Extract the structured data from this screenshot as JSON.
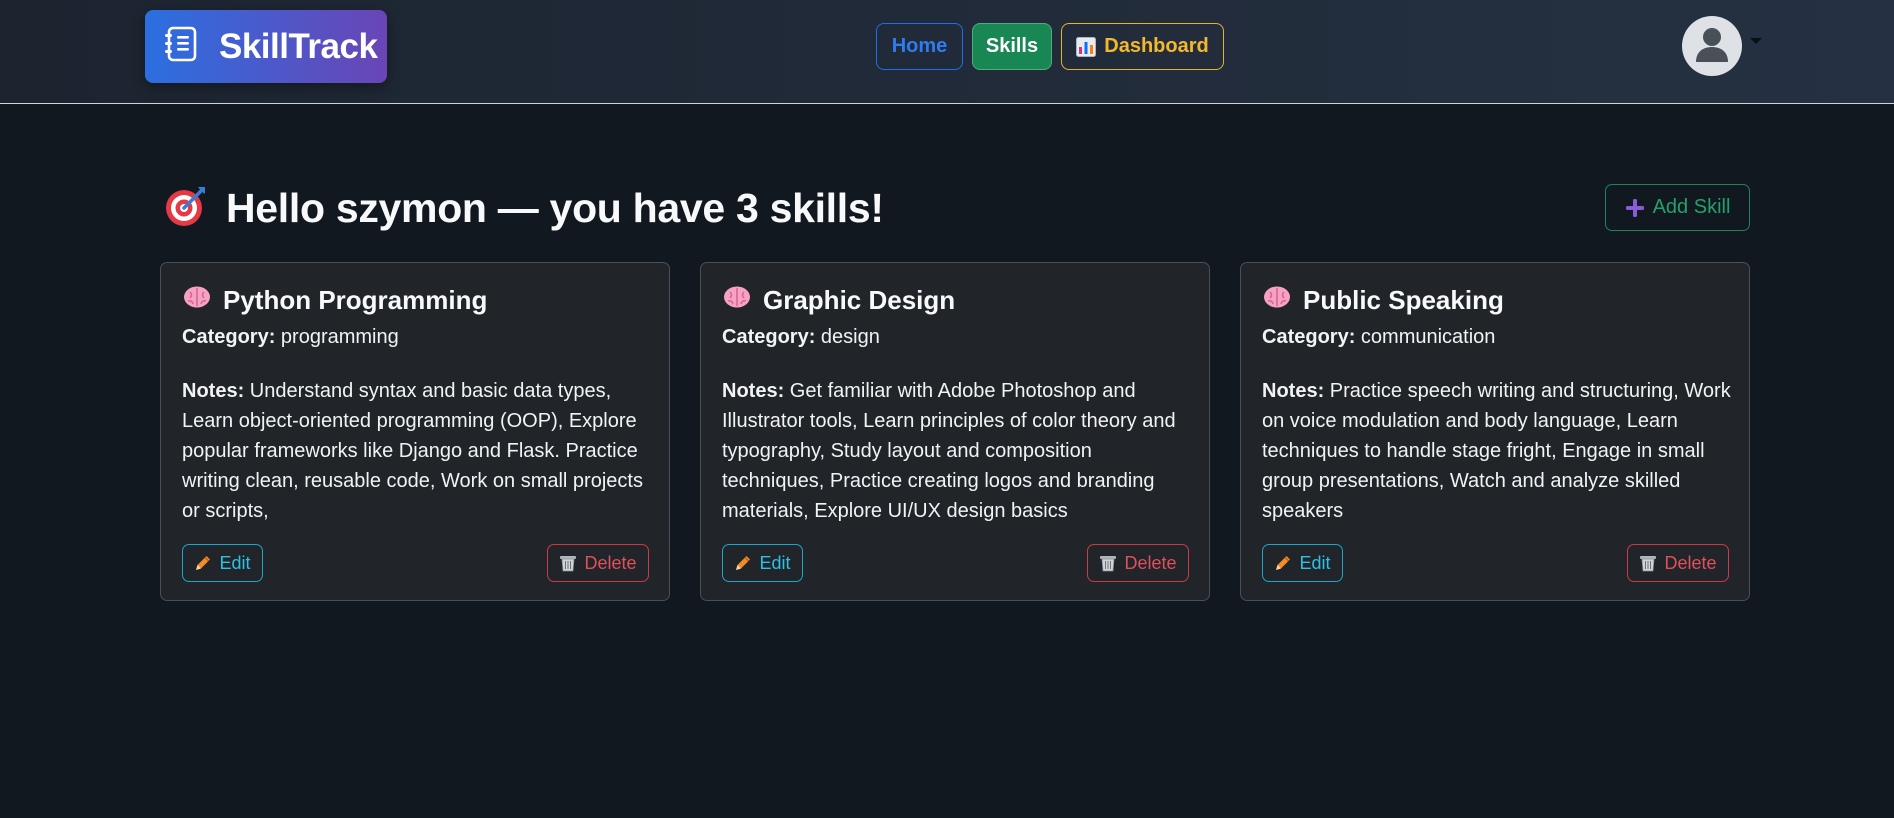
{
  "navbar": {
    "brand": "SkillTrack",
    "links": [
      {
        "label": "Home"
      },
      {
        "label": "Skills"
      },
      {
        "label": "Dashboard"
      }
    ]
  },
  "heading": {
    "text": "Hello szymon — you have 3 skills!"
  },
  "add_button": {
    "label": "Add Skill"
  },
  "labels": {
    "category": "Category:",
    "notes": "Notes:",
    "edit": "Edit",
    "delete": "Delete"
  },
  "skills": [
    {
      "title": "Python Programming",
      "category": "programming",
      "notes": "Understand syntax and basic data types, Learn object-oriented programming (OOP), Explore popular frameworks like Django and Flask. Practice writing clean, reusable code, Work on small projects or scripts,"
    },
    {
      "title": "Graphic Design",
      "category": "design",
      "notes": "Get familiar with Adobe Photoshop and Illustrator tools, Learn principles of color theory and typography, Study layout and composition techniques, Practice creating logos and branding materials, Explore UI/UX design basics"
    },
    {
      "title": "Public Speaking",
      "category": "communication",
      "notes": "Practice speech writing and structuring, Work on voice modulation and body language, Learn techniques to handle stage fright, Engage in small group presentations, Watch and analyze skilled speakers"
    }
  ],
  "colors": {
    "background": "#121820",
    "card": "#212429",
    "brand_start": "#2b6fe0",
    "brand_end": "#6a45b6",
    "success": "#198754",
    "info": "#1aa7c9",
    "danger": "#c93c47",
    "warning": "#e5b330",
    "primary": "#1f6ee6"
  },
  "icons": {
    "brand": "notebook-icon",
    "dashboard": "bar-chart-icon",
    "avatar": "user-silhouette-icon",
    "heading": "target-dart-icon",
    "add": "plus-icon",
    "skill": "brain-icon",
    "edit": "pencil-icon",
    "delete": "wastebasket-icon"
  }
}
